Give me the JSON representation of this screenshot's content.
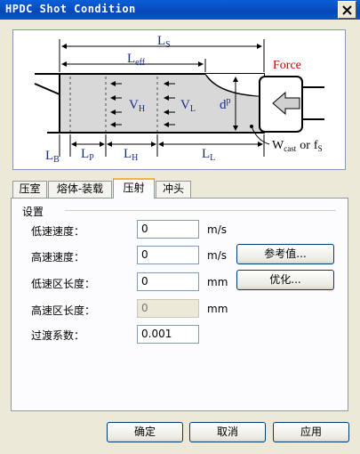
{
  "window": {
    "title": "HPDC Shot Condition"
  },
  "diagram": {
    "labels": {
      "ls_main": "L",
      "ls_sub": "S",
      "leff_main": "L",
      "leff_sub": "eff",
      "force": "Force",
      "vh_main": "V",
      "vh_sub": "H",
      "vl_main": "V",
      "vl_sub": "L",
      "dp_main": "d",
      "dp_sub": "p",
      "lb_main": "L",
      "lb_sub": "B",
      "lp_main": "L",
      "lp_sub": "P",
      "lh_main": "L",
      "lh_sub": "H",
      "ll_main": "L",
      "ll_sub": "L",
      "w_main": "W",
      "w_sub": "cast",
      "or_text": "or",
      "f_main": "f",
      "f_sub": "S"
    }
  },
  "tabs": [
    {
      "label": "压室",
      "active": false
    },
    {
      "label": "熔体-装载",
      "active": false
    },
    {
      "label": "压射",
      "active": true
    },
    {
      "label": "冲头",
      "active": false
    }
  ],
  "settings": {
    "group_label": "设置",
    "rows": [
      {
        "label": "低速速度：",
        "value": "0",
        "unit": "m/s",
        "enabled": true
      },
      {
        "label": "高速速度：",
        "value": "0",
        "unit": "m/s",
        "enabled": true
      },
      {
        "label": "低速区长度：",
        "value": "0",
        "unit": "mm",
        "enabled": true
      },
      {
        "label": "高速区长度：",
        "value": "0",
        "unit": "mm",
        "enabled": false
      },
      {
        "label": "过渡系数：",
        "value": "0.001",
        "unit": "",
        "enabled": true
      }
    ],
    "reference_button": "参考值...",
    "optimize_button": "优化..."
  },
  "footer": {
    "ok": "确定",
    "cancel": "取消",
    "apply": "应用"
  },
  "colors": {
    "diagram_label": "#1a2a8a",
    "force": "#c00000",
    "tab_highlight": "#f6b43c"
  }
}
